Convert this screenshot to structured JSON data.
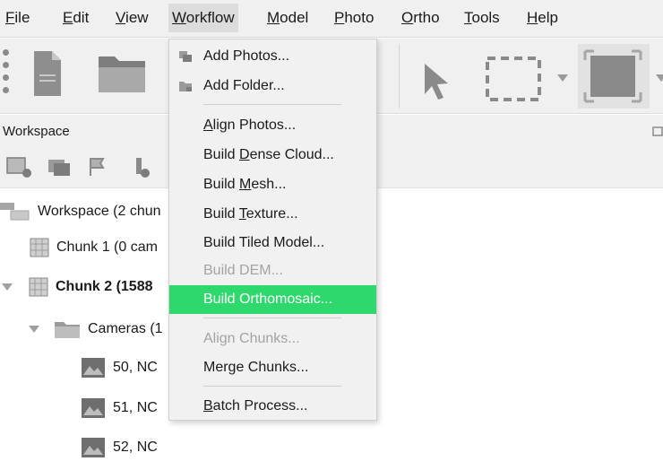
{
  "menubar": {
    "items": [
      {
        "pre": "",
        "u": "F",
        "post": "ile"
      },
      {
        "pre": "",
        "u": "E",
        "post": "dit"
      },
      {
        "pre": "",
        "u": "V",
        "post": "iew"
      },
      {
        "pre": "",
        "u": "W",
        "post": "orkflow"
      },
      {
        "pre": "",
        "u": "M",
        "post": "odel"
      },
      {
        "pre": "",
        "u": "P",
        "post": "hoto"
      },
      {
        "pre": "",
        "u": "O",
        "post": "rtho"
      },
      {
        "pre": "",
        "u": "T",
        "post": "ools"
      },
      {
        "pre": "",
        "u": "H",
        "post": "elp"
      }
    ]
  },
  "workspace": {
    "title": "Workspace",
    "tree": {
      "root": "Workspace (2 chun",
      "chunk1": "Chunk 1 (0 cam",
      "chunk2": "Chunk 2 (1588",
      "cameras": "Cameras (1",
      "photos": [
        "50, NC",
        "51, NC",
        "52, NC"
      ]
    }
  },
  "workflow_menu": {
    "add_photos": "Add Photos...",
    "add_folder": "Add Folder...",
    "align_photos": {
      "pre": "",
      "u": "A",
      "post": "lign Photos..."
    },
    "build_dense_cloud": {
      "pre": "Build ",
      "u": "D",
      "post": "ense Cloud..."
    },
    "build_mesh": {
      "pre": "Build ",
      "u": "M",
      "post": "esh..."
    },
    "build_texture": {
      "pre": "Build ",
      "u": "T",
      "post": "exture..."
    },
    "build_tiled_model": "Build Tiled Model...",
    "build_dem": "Build DEM...",
    "build_orthomosaic": "Build Orthomosaic...",
    "align_chunks": "Align Chunks...",
    "merge_chunks": "Merge Chunks...",
    "batch_process": {
      "pre": "",
      "u": "B",
      "post": "atch Process..."
    }
  },
  "colors": {
    "highlight": "#2fd86c",
    "menu_bg": "#f1f1f1",
    "toolbar_bg": "#f0f0f0"
  }
}
